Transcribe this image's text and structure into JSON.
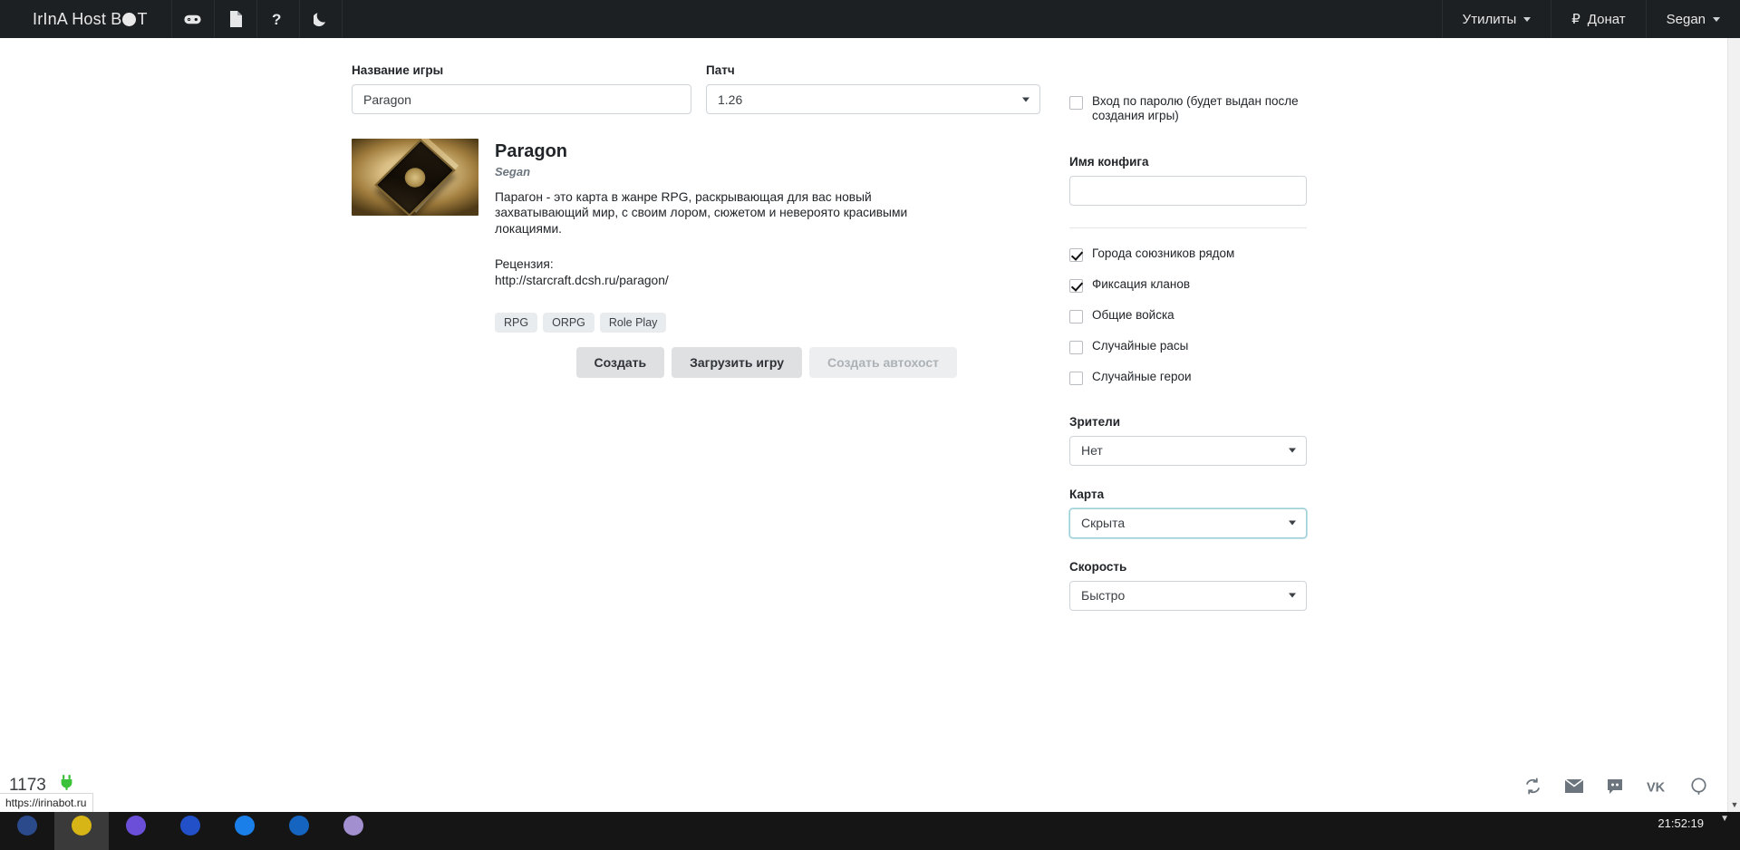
{
  "navbar": {
    "brand_left": "IrInA Host B",
    "brand_right": "T",
    "icons": [
      {
        "name": "gamepad-icon",
        "glyph": "gamepad"
      },
      {
        "name": "document-icon",
        "glyph": "document"
      },
      {
        "name": "help-icon",
        "glyph": "question"
      },
      {
        "name": "dark-mode-icon",
        "glyph": "moon"
      }
    ],
    "utilities_label": "Утилиты",
    "donate_label": "Донат",
    "donate_currency": "₽",
    "user_label": "Segan"
  },
  "form": {
    "game_name_label": "Название игры",
    "game_name_value": "Paragon",
    "patch_label": "Патч",
    "patch_value": "1.26"
  },
  "map": {
    "title": "Paragon",
    "author": "Segan",
    "description": "Парагон - это карта в жанре RPG, раскрывающая для вас новый захватывающий мир, с своим лором, сюжетом и невероято красивыми локациями.",
    "review_label": "Рецензия:",
    "review_url": "http://starcraft.dcsh.ru/paragon/",
    "tags": [
      "RPG",
      "ORPG",
      "Role Play"
    ]
  },
  "buttons": {
    "create": "Создать",
    "load_game": "Загрузить игру",
    "create_autohost": "Создать автохост"
  },
  "sidebar": {
    "password_checkbox": {
      "label": "Вход по паролю (будет выдан после создания игры)",
      "checked": false
    },
    "config_name_label": "Имя конфига",
    "config_name_value": "",
    "options": [
      {
        "label": "Города союзников рядом",
        "checked": true
      },
      {
        "label": "Фиксация кланов",
        "checked": true
      },
      {
        "label": "Общие войска",
        "checked": false
      },
      {
        "label": "Случайные расы",
        "checked": false
      },
      {
        "label": "Случайные герои",
        "checked": false
      }
    ],
    "selects": [
      {
        "label": "Зрители",
        "value": "Нет",
        "focused": false
      },
      {
        "label": "Карта",
        "value": "Скрыта",
        "focused": true
      },
      {
        "label": "Скорость",
        "value": "Быстро",
        "focused": false
      }
    ]
  },
  "footer": {
    "icons": [
      {
        "name": "refresh-icon"
      },
      {
        "name": "email-icon"
      },
      {
        "name": "discord-icon"
      },
      {
        "name": "vk-icon"
      },
      {
        "name": "github-icon"
      }
    ]
  },
  "status": {
    "counter": "1173",
    "connection_icon": "plug-icon",
    "link_tooltip": "https://irinabot.ru"
  },
  "taskbar": {
    "clock": "21:52:19"
  },
  "colors": {
    "navbar_bg": "#1d2022",
    "accent_focus": "#9ecfd6",
    "connected_green": "#3cc13b",
    "button_bg": "#dee0e2",
    "tag_bg": "#e9ecef"
  }
}
